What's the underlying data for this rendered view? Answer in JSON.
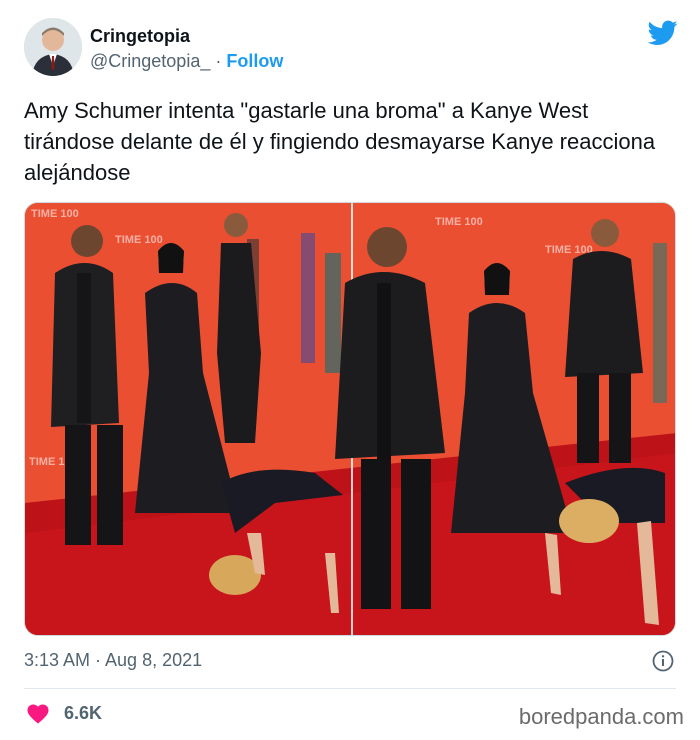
{
  "tweet": {
    "author_name": "Cringetopia",
    "author_handle": "@Cringetopia_",
    "separator": "·",
    "follow_label": "Follow",
    "text": "Amy Schumer intenta \"gastarle una broma\" a Kanye West tirándose delante de él y fingiendo desmayarse Kanye reacciona alejándose",
    "timestamp": "3:13 AM · Aug 8, 2021",
    "likes": "6.6K"
  },
  "photo": {
    "backdrop_text": "TIME 100"
  },
  "watermark": "boredpanda.com",
  "colors": {
    "accent": "#1d9bf0",
    "like_heart": "#f91880",
    "text_primary": "#0f1419",
    "text_secondary": "#536471",
    "carpet": "#c8141b",
    "backdrop": "#e9452c"
  },
  "icons": [
    "twitter-bird-icon",
    "info-icon",
    "heart-icon"
  ]
}
